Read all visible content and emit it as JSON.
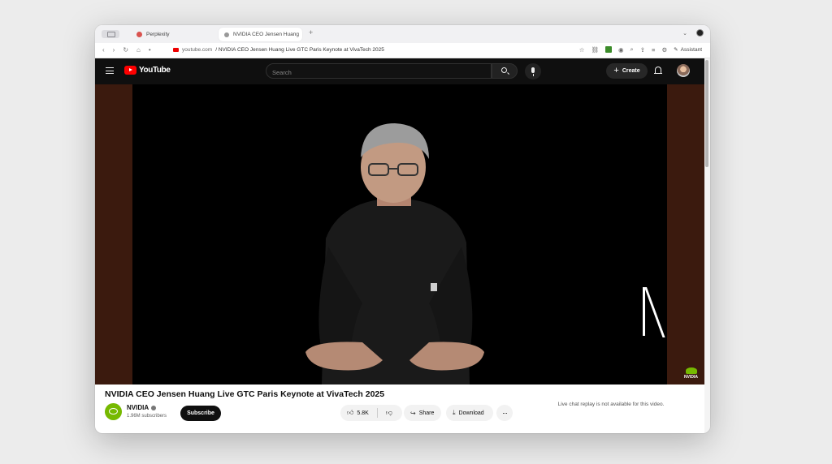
{
  "browser": {
    "tabs": [
      {
        "label": "Perplexity",
        "active": false
      },
      {
        "label": "NVIDIA CEO Jensen Huang",
        "active": true
      }
    ],
    "new_tab_symbol": "+",
    "url_domain": "youtube.com",
    "url_path": " / NVIDIA CEO Jensen Huang Live GTC Paris Keynote at VivaTech 2025",
    "assistant_label": "Assistant"
  },
  "youtube": {
    "logo_text": "YouTube",
    "search_placeholder": "Search",
    "create_label": "Create"
  },
  "video": {
    "title": "NVIDIA CEO Jensen Huang Live GTC Paris Keynote at VivaTech 2025",
    "watermark_text": "NVIDIA"
  },
  "channel": {
    "name": "NVIDIA",
    "subscribers": "1.96M subscribers",
    "subscribe_label": "Subscribe"
  },
  "actions": {
    "likes": "5.8K",
    "share_label": "Share",
    "download_label": "Download",
    "more_label": "···"
  },
  "chat": {
    "note": "Live chat replay is not available for this video."
  },
  "colors": {
    "youtube_red": "#ff0000",
    "nvidia_green": "#76b900",
    "header_bg": "#0f0f0f"
  }
}
